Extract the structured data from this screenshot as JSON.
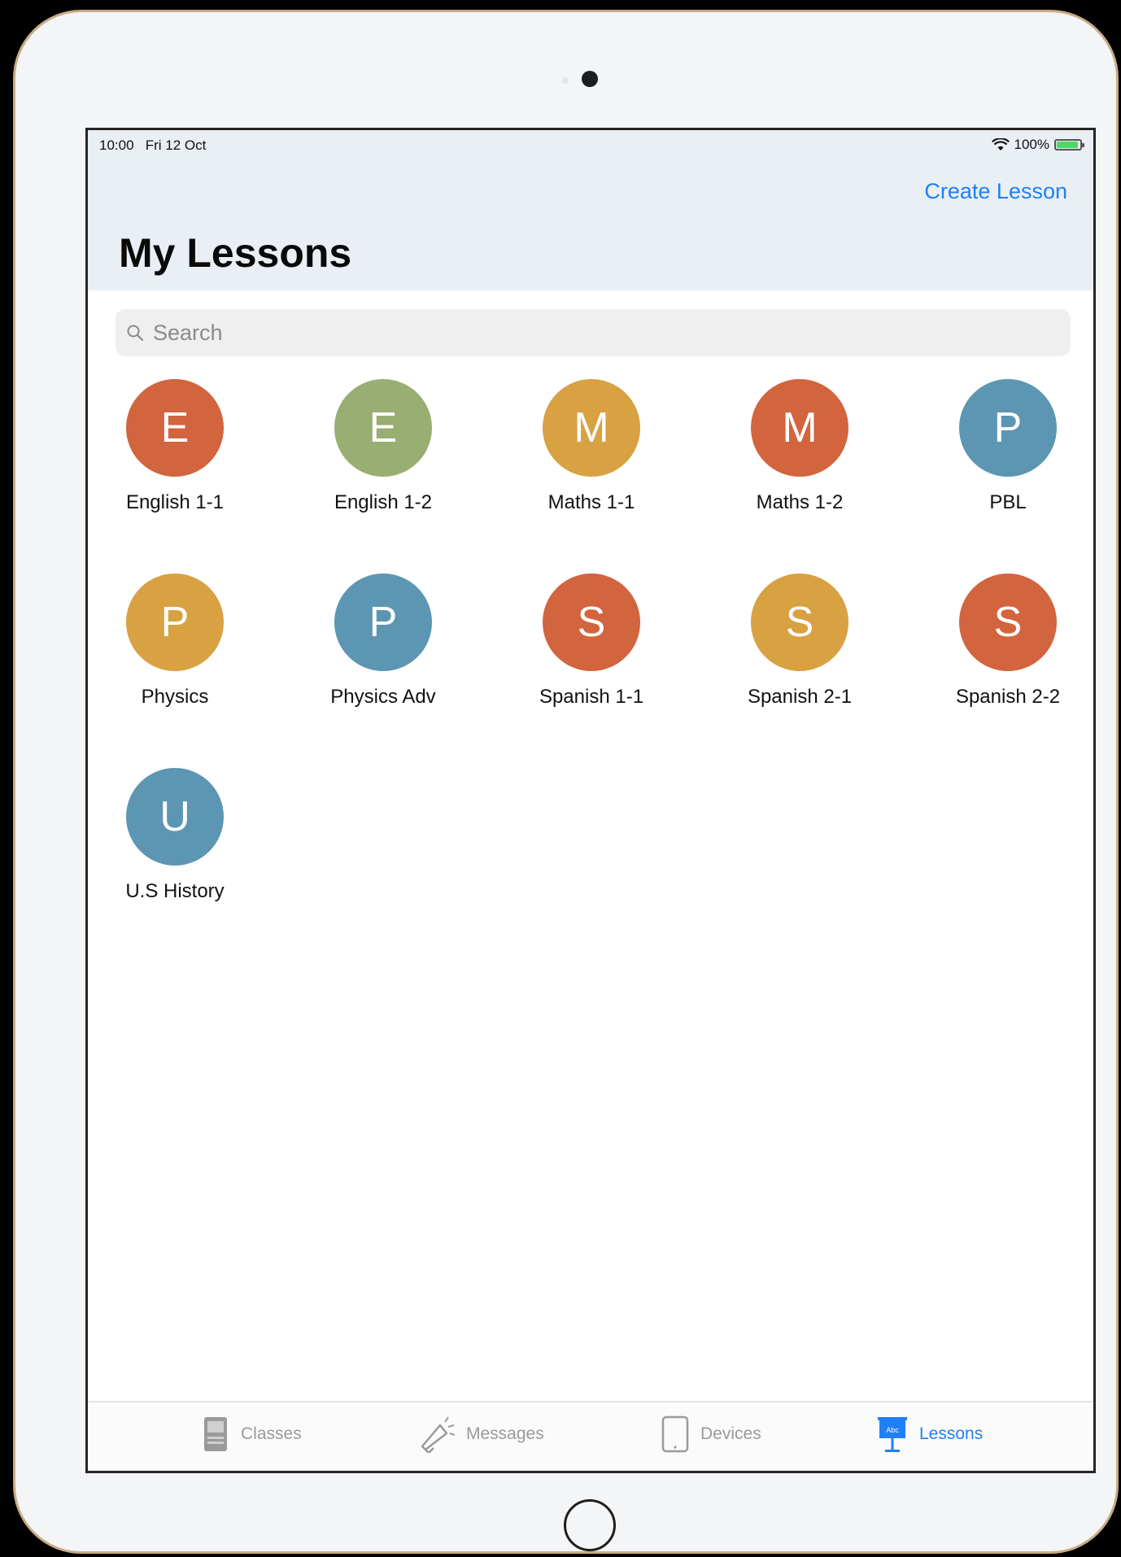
{
  "status_bar": {
    "time": "10:00",
    "date": "Fri 12 Oct",
    "battery": "100%"
  },
  "nav": {
    "action_label": "Create Lesson",
    "title": "My Lessons"
  },
  "search": {
    "placeholder": "Search"
  },
  "lessons": [
    {
      "initial": "E",
      "name": "English 1-1",
      "color": "#d2643e"
    },
    {
      "initial": "E",
      "name": "English 1-2",
      "color": "#99ae72"
    },
    {
      "initial": "M",
      "name": "Maths 1-1",
      "color": "#d8a141"
    },
    {
      "initial": "M",
      "name": "Maths 1-2",
      "color": "#d2643e"
    },
    {
      "initial": "P",
      "name": "PBL",
      "color": "#5c96b2"
    },
    {
      "initial": "P",
      "name": "Physics",
      "color": "#d8a141"
    },
    {
      "initial": "P",
      "name": "Physics Adv",
      "color": "#5c96b2"
    },
    {
      "initial": "S",
      "name": "Spanish 1-1",
      "color": "#d2643e"
    },
    {
      "initial": "S",
      "name": "Spanish 2-1",
      "color": "#d8a141"
    },
    {
      "initial": "S",
      "name": "Spanish 2-2",
      "color": "#d2643e"
    },
    {
      "initial": "U",
      "name": "U.S History",
      "color": "#5c96b2"
    }
  ],
  "tabs": [
    {
      "label": "Classes",
      "icon": "classes-icon",
      "active": false
    },
    {
      "label": "Messages",
      "icon": "megaphone-icon",
      "active": false
    },
    {
      "label": "Devices",
      "icon": "ipad-icon",
      "active": false
    },
    {
      "label": "Lessons",
      "icon": "lesson-board-icon",
      "active": true
    }
  ],
  "colors": {
    "accent": "#1f7ff6",
    "nav_background": "#e9eff4",
    "device_bezel": "#f3f5f7"
  }
}
